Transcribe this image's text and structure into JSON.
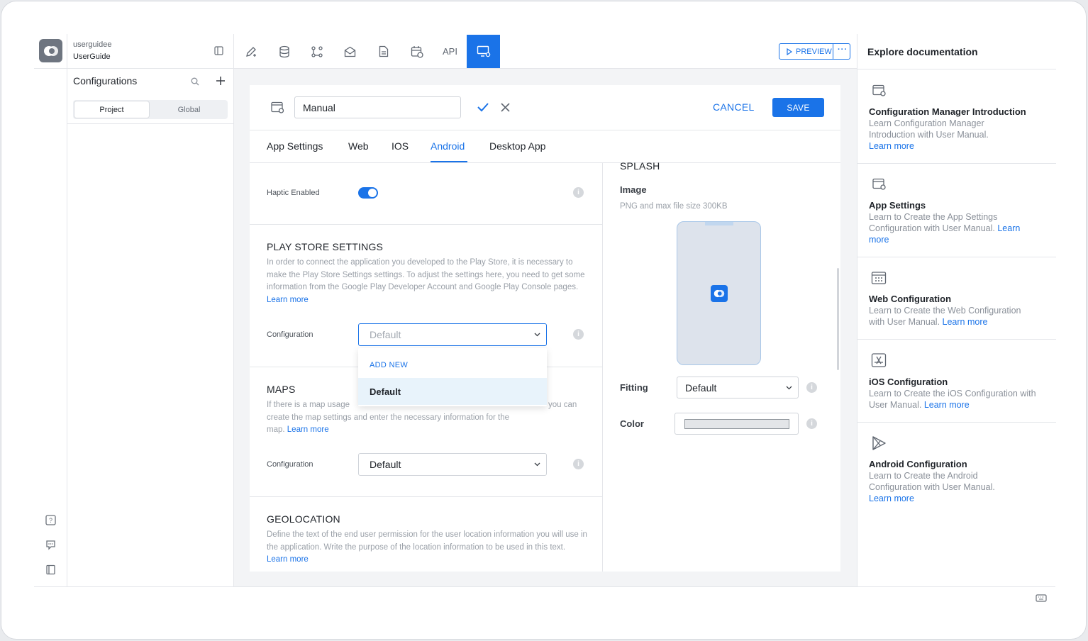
{
  "workspace": {
    "top_label": "userguidee",
    "name": "UserGuide"
  },
  "config_panel": {
    "title": "Configurations",
    "segments": [
      "Project",
      "Global"
    ]
  },
  "toolbar": {
    "api_label": "API",
    "preview_label": "PREVIEW"
  },
  "editor": {
    "name_value": "Manual",
    "cancel_label": "CANCEL",
    "save_label": "SAVE",
    "tabs": [
      "App Settings",
      "Web",
      "IOS",
      "Android",
      "Desktop App"
    ],
    "active_tab": "Android"
  },
  "haptic": {
    "label": "Haptic Enabled",
    "enabled": true
  },
  "play_store": {
    "title": "PLAY STORE SETTINGS",
    "description": "In order to connect the application you developed to the Play Store, it is necessary to make the Play Store Settings settings. To adjust the settings here, you need to get some information from the Google Play Developer Account and Google Play Console pages.",
    "learn_more": "Learn more",
    "config_label": "Configuration",
    "config_placeholder": "Default",
    "dropdown": {
      "add_new": "ADD NEW",
      "option": "Default"
    }
  },
  "maps": {
    "title": "MAPS",
    "desc_line1_left": "If there is a map usage",
    "desc_line1_right": "you can",
    "desc_line2": "create the map settings and enter the necessary information for the",
    "desc_line3": "map.",
    "learn_more": "Learn more",
    "config_label": "Configuration",
    "config_value": "Default"
  },
  "geolocation": {
    "title": "GEOLOCATION",
    "description": "Define the text of the end user permission for the user location information you will use in the application. Write the purpose of the location information to be used in this text.",
    "learn_more": "Learn more"
  },
  "splash": {
    "title": "SPLASH",
    "image_label": "Image",
    "image_hint": "PNG and max file size 300KB",
    "fitting_label": "Fitting",
    "fitting_value": "Default",
    "color_label": "Color"
  },
  "docs": {
    "title": "Explore documentation",
    "items": [
      {
        "icon": "browser-gear-icon",
        "title": "Configuration Manager Introduction",
        "desc": "Learn Configuration Manager Introduction with User Manual.",
        "link": "Learn more"
      },
      {
        "icon": "browser-gear-icon",
        "title": "App Settings",
        "desc": "Learn to Create the App Settings Configuration with User Manual.",
        "link": "Learn more"
      },
      {
        "icon": "calendar-grid-icon",
        "title": "Web Configuration",
        "desc": "Learn to Create the Web Configuration with User Manual.",
        "link": "Learn more"
      },
      {
        "icon": "app-store-icon",
        "title": "iOS Configuration",
        "desc": "Learn to Create the iOS Configuration with User Manual.",
        "link": "Learn more"
      },
      {
        "icon": "play-store-icon",
        "title": "Android Configuration",
        "desc": "Learn to Create the Android Configuration with User Manual.",
        "link": "Learn more"
      }
    ]
  },
  "colors": {
    "accent": "#1a73e8",
    "content_bg": "#f3f4f6"
  }
}
